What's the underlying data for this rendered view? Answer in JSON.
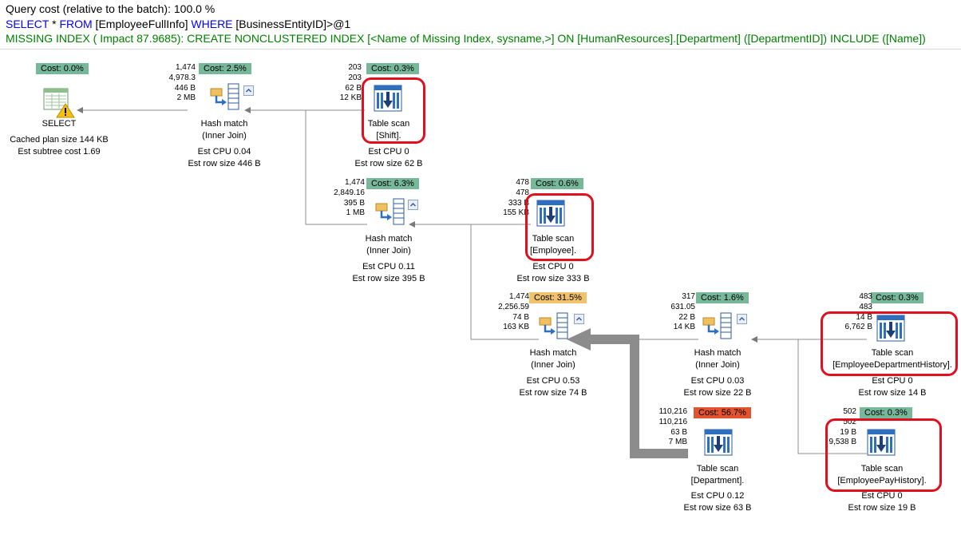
{
  "header": {
    "query_cost_text": "Query cost (relative to the batch):  100.0 %",
    "sql": {
      "select_kw": "SELECT",
      "star_from": " * ",
      "from_kw": "FROM",
      "table": " [EmployeeFullInfo] ",
      "where_kw": "WHERE",
      "cond": " [BusinessEntityID]>@1"
    },
    "missing_index_text": "MISSING INDEX ( Impact 87.9685): CREATE NONCLUSTERED INDEX [<Name of Missing Index, sysname,>] ON [HumanResources].[Department]   ([DepartmentID]) INCLUDE  ([Name])"
  },
  "colors": {
    "cost_green": "#78b89a",
    "cost_orange": "#f1c26e",
    "cost_red": "#e2542f",
    "highlight": "#e0101f"
  },
  "nodes": {
    "select": {
      "cost": "Cost: 0.0%",
      "title": "SELECT",
      "cached": "Cached plan size  144 KB",
      "subtree": "Est subtree cost  1.69"
    },
    "hash1": {
      "cost": "Cost: 2.5%",
      "stats": [
        "1,474",
        "4,978.3",
        "446 B",
        "2 MB"
      ],
      "title": "Hash match",
      "sub": "(Inner Join)",
      "cpu": "Est CPU  0.04",
      "rows": "Est row size  446 B"
    },
    "shift": {
      "cost": "Cost: 0.3%",
      "stats": [
        "203",
        "203",
        "62 B",
        "12 KB"
      ],
      "title": "Table scan",
      "sub": "[Shift].",
      "cpu": "Est CPU  0",
      "rows": "Est row size  62 B"
    },
    "hash2": {
      "cost": "Cost: 6.3%",
      "stats": [
        "1,474",
        "2,849.16",
        "395 B",
        "1 MB"
      ],
      "title": "Hash match",
      "sub": "(Inner Join)",
      "cpu": "Est CPU  0.11",
      "rows": "Est row size  395 B"
    },
    "employee": {
      "cost": "Cost: 0.6%",
      "stats": [
        "478",
        "478",
        "333 B",
        "155 KB"
      ],
      "title": "Table scan",
      "sub": "[Employee].",
      "cpu": "Est CPU  0",
      "rows": "Est row size  333 B"
    },
    "hash3": {
      "cost": "Cost: 31.5%",
      "stats": [
        "1,474",
        "2,256.59",
        "74 B",
        "163 KB"
      ],
      "title": "Hash match",
      "sub": "(Inner Join)",
      "cpu": "Est CPU  0.53",
      "rows": "Est row size  74 B"
    },
    "hash4": {
      "cost": "Cost: 1.6%",
      "stats": [
        "317",
        "631.05",
        "22 B",
        "14 KB"
      ],
      "title": "Hash match",
      "sub": "(Inner Join)",
      "cpu": "Est CPU  0.03",
      "rows": "Est row size  22 B"
    },
    "edh": {
      "cost": "Cost: 0.3%",
      "stats": [
        "483",
        "483",
        "14 B",
        "6,762 B"
      ],
      "title": "Table scan",
      "sub": "[EmployeeDepartmentHistory].",
      "cpu": "Est CPU  0",
      "rows": "Est row size  14 B"
    },
    "department": {
      "cost": "Cost: 56.7%",
      "stats": [
        "110,216",
        "110,216",
        "63 B",
        "7 MB"
      ],
      "title": "Table scan",
      "sub": "[Department].",
      "cpu": "Est CPU  0.12",
      "rows": "Est row size  63 B"
    },
    "eph": {
      "cost": "Cost: 0.3%",
      "stats": [
        "502",
        "502",
        "19 B",
        "9,538 B"
      ],
      "title": "Table scan",
      "sub": "[EmployeePayHistory].",
      "cpu": "Est CPU  0",
      "rows": "Est row size  19 B"
    }
  }
}
